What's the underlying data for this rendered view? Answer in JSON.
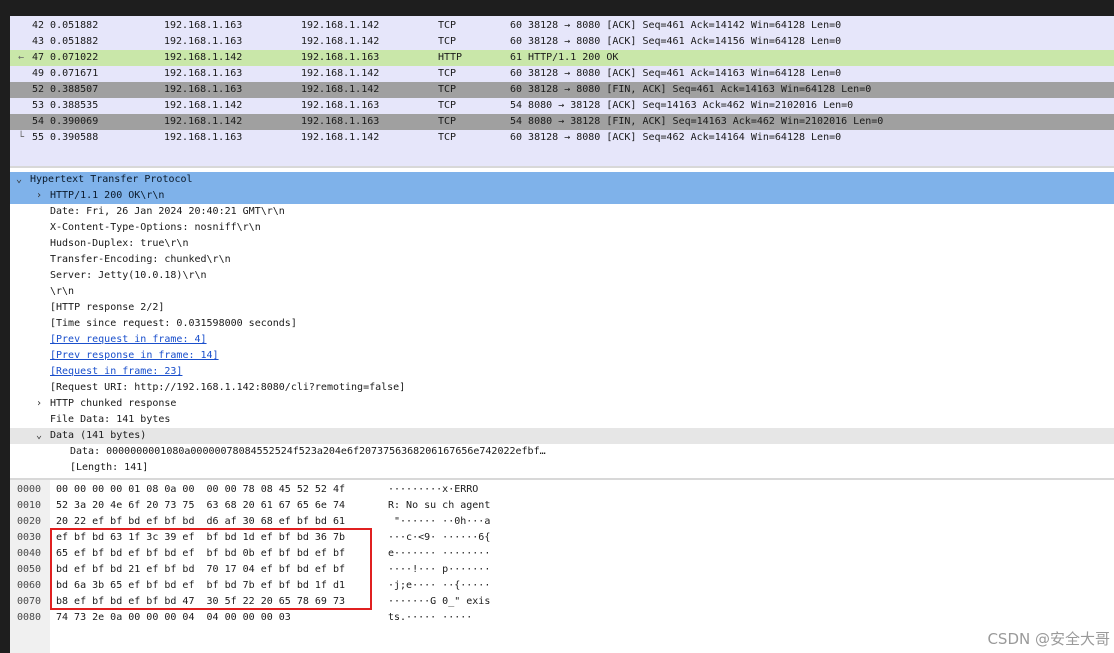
{
  "packets": [
    {
      "no_time": "42 0.051882",
      "src": "192.168.1.163",
      "dst": "192.168.1.142",
      "proto": "TCP",
      "info": "60 38128 → 8080 [ACK] Seq=461 Ack=14142 Win=64128 Len=0",
      "style": "normal",
      "gutter": ""
    },
    {
      "no_time": "43 0.051882",
      "src": "192.168.1.163",
      "dst": "192.168.1.142",
      "proto": "TCP",
      "info": "60 38128 → 8080 [ACK] Seq=461 Ack=14156 Win=64128 Len=0",
      "style": "normal",
      "gutter": ""
    },
    {
      "no_time": "47 0.071022",
      "src": "192.168.1.142",
      "dst": "192.168.1.163",
      "proto": "HTTP",
      "info": "61 HTTP/1.1 200 OK",
      "style": "http",
      "gutter": "←"
    },
    {
      "no_time": "49 0.071671",
      "src": "192.168.1.163",
      "dst": "192.168.1.142",
      "proto": "TCP",
      "info": "60 38128 → 8080 [ACK] Seq=461 Ack=14163 Win=64128 Len=0",
      "style": "normal",
      "gutter": ""
    },
    {
      "no_time": "52 0.388507",
      "src": "192.168.1.163",
      "dst": "192.168.1.142",
      "proto": "TCP",
      "info": "60 38128 → 8080 [FIN, ACK] Seq=461 Ack=14163 Win=64128 Len=0",
      "style": "fin",
      "gutter": ""
    },
    {
      "no_time": "53 0.388535",
      "src": "192.168.1.142",
      "dst": "192.168.1.163",
      "proto": "TCP",
      "info": "54 8080 → 38128 [ACK] Seq=14163 Ack=462 Win=2102016 Len=0",
      "style": "normal",
      "gutter": ""
    },
    {
      "no_time": "54 0.390069",
      "src": "192.168.1.142",
      "dst": "192.168.1.163",
      "proto": "TCP",
      "info": "54 8080 → 38128 [FIN, ACK] Seq=14163 Ack=462 Win=2102016 Len=0",
      "style": "fin",
      "gutter": ""
    },
    {
      "no_time": "55 0.390588",
      "src": "192.168.1.163",
      "dst": "192.168.1.142",
      "proto": "TCP",
      "info": "60 38128 → 8080 [ACK] Seq=462 Ack=14164 Win=64128 Len=0",
      "style": "normal",
      "gutter": "└"
    }
  ],
  "tree": [
    {
      "arrow": "⌄",
      "indent": 0,
      "text": "Hypertext Transfer Protocol",
      "style": "hl",
      "link": false
    },
    {
      "arrow": "›",
      "indent": 1,
      "text": "HTTP/1.1 200 OK\\r\\n",
      "style": "hl",
      "link": false
    },
    {
      "arrow": "",
      "indent": 1,
      "text": "Date: Fri, 26 Jan 2024 20:40:21 GMT\\r\\n",
      "style": "",
      "link": false
    },
    {
      "arrow": "",
      "indent": 1,
      "text": "X-Content-Type-Options: nosniff\\r\\n",
      "style": "",
      "link": false
    },
    {
      "arrow": "",
      "indent": 1,
      "text": "Hudson-Duplex: true\\r\\n",
      "style": "",
      "link": false
    },
    {
      "arrow": "",
      "indent": 1,
      "text": "Transfer-Encoding: chunked\\r\\n",
      "style": "",
      "link": false
    },
    {
      "arrow": "",
      "indent": 1,
      "text": "Server: Jetty(10.0.18)\\r\\n",
      "style": "",
      "link": false
    },
    {
      "arrow": "",
      "indent": 1,
      "text": "\\r\\n",
      "style": "",
      "link": false
    },
    {
      "arrow": "",
      "indent": 1,
      "text": "[HTTP response 2/2]",
      "style": "",
      "link": false
    },
    {
      "arrow": "",
      "indent": 1,
      "text": "[Time since request: 0.031598000 seconds]",
      "style": "",
      "link": false
    },
    {
      "arrow": "",
      "indent": 1,
      "text": "[Prev request in frame: 4]",
      "style": "",
      "link": true
    },
    {
      "arrow": "",
      "indent": 1,
      "text": "[Prev response in frame: 14]",
      "style": "",
      "link": true
    },
    {
      "arrow": "",
      "indent": 1,
      "text": "[Request in frame: 23]",
      "style": "",
      "link": true
    },
    {
      "arrow": "",
      "indent": 1,
      "text": "[Request URI: http://192.168.1.142:8080/cli?remoting=false]",
      "style": "",
      "link": false
    },
    {
      "arrow": "›",
      "indent": 1,
      "text": "HTTP chunked response",
      "style": "",
      "link": false
    },
    {
      "arrow": "",
      "indent": 1,
      "text": "File Data: 141 bytes",
      "style": "",
      "link": false
    },
    {
      "arrow": "⌄",
      "indent": 1,
      "text": "Data (141 bytes)",
      "style": "sub",
      "link": false
    },
    {
      "arrow": "",
      "indent": 2,
      "text": "Data: 0000000001080a00000078084552524f523a204e6f2073756368206167656e742022efbf…",
      "style": "",
      "link": false
    },
    {
      "arrow": "",
      "indent": 2,
      "text": "[Length: 141]",
      "style": "",
      "link": false
    }
  ],
  "hex": [
    {
      "off": "0000",
      "bytes": "00 00 00 00 01 08 0a 00  00 00 78 08 45 52 52 4f",
      "ascii": "·········x·ERRO"
    },
    {
      "off": "0010",
      "bytes": "52 3a 20 4e 6f 20 73 75  63 68 20 61 67 65 6e 74",
      "ascii": "R: No su ch agent"
    },
    {
      "off": "0020",
      "bytes": "20 22 ef bf bd ef bf bd  d6 af 30 68 ef bf bd 61",
      "ascii": " \"······ ··0h···a"
    },
    {
      "off": "0030",
      "bytes": "ef bf bd 63 1f 3c 39 ef  bf bd 1d ef bf bd 36 7b",
      "ascii": "···c·<9· ······6{"
    },
    {
      "off": "0040",
      "bytes": "65 ef bf bd ef bf bd ef  bf bd 0b ef bf bd ef bf",
      "ascii": "e······· ········"
    },
    {
      "off": "0050",
      "bytes": "bd ef bf bd 21 ef bf bd  70 17 04 ef bf bd ef bf",
      "ascii": "····!··· p·······"
    },
    {
      "off": "0060",
      "bytes": "bd 6a 3b 65 ef bf bd ef  bf bd 7b ef bf bd 1f d1",
      "ascii": "·j;e···· ··{·····"
    },
    {
      "off": "0070",
      "bytes": "b8 ef bf bd ef bf bd 47  30 5f 22 20 65 78 69 73",
      "ascii": "·······G 0_\" exis"
    },
    {
      "off": "0080",
      "bytes": "74 73 2e 0a 00 00 00 04  04 00 00 00 03",
      "ascii": "ts.····· ·····"
    }
  ],
  "watermark": "CSDN @安全大哥"
}
